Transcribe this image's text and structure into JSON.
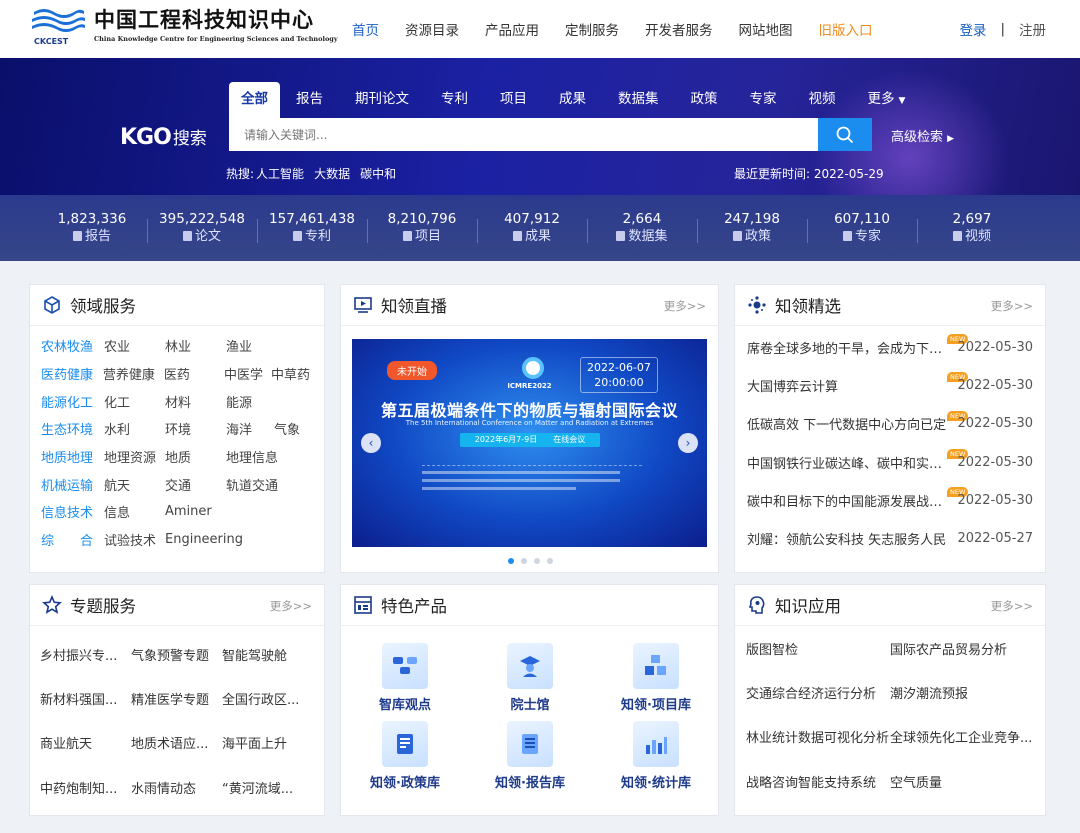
{
  "header": {
    "logo_cn": "中国工程科技知识中心",
    "logo_en": "China Knowledge Centre for Engineering Sciences and Technology",
    "logo_abbr": "CKCEST",
    "nav": [
      "首页",
      "资源目录",
      "产品应用",
      "定制服务",
      "开发者服务",
      "网站地图",
      "旧版入口"
    ],
    "login": "登录",
    "separator": "|",
    "register": "注册"
  },
  "search": {
    "brand": "KGO",
    "brand_cn": "搜索",
    "tabs": [
      "全部",
      "报告",
      "期刊论文",
      "专利",
      "项目",
      "成果",
      "数据集",
      "政策",
      "专家",
      "视频",
      "更多"
    ],
    "placeholder": "请输入关键词...",
    "advanced": "高级检索",
    "hot_label": "热搜:",
    "hot": [
      "人工智能",
      "大数据",
      "碳中和"
    ],
    "update_label": "最近更新时间:",
    "update_date": "2022-05-29"
  },
  "stats": [
    {
      "num": "1,823,336",
      "label": "报告"
    },
    {
      "num": "395,222,548",
      "label": "论文"
    },
    {
      "num": "157,461,438",
      "label": "专利"
    },
    {
      "num": "8,210,796",
      "label": "项目"
    },
    {
      "num": "407,912",
      "label": "成果"
    },
    {
      "num": "2,664",
      "label": "数据集"
    },
    {
      "num": "247,198",
      "label": "政策"
    },
    {
      "num": "607,110",
      "label": "专家"
    },
    {
      "num": "2,697",
      "label": "视频"
    }
  ],
  "domain": {
    "title": "领域服务",
    "rows": [
      {
        "cat": "农林牧渔",
        "items": [
          "农业",
          "林业",
          "渔业"
        ]
      },
      {
        "cat": "医药健康",
        "items": [
          "营养健康",
          "医药",
          "中医学",
          "中草药"
        ]
      },
      {
        "cat": "能源化工",
        "items": [
          "化工",
          "材料",
          "能源"
        ]
      },
      {
        "cat": "生态环境",
        "items": [
          "水利",
          "环境",
          "海洋",
          "气象"
        ]
      },
      {
        "cat": "地质地理",
        "items": [
          "地理资源",
          "地质",
          "地理信息"
        ]
      },
      {
        "cat": "机械运输",
        "items": [
          "航天",
          "交通",
          "轨道交通"
        ]
      },
      {
        "cat": "信息技术",
        "items": [
          "信息",
          "Aminer"
        ]
      },
      {
        "cat": "综　　合",
        "items": [
          "试验技术",
          "Engineering"
        ]
      }
    ]
  },
  "live": {
    "title": "知领直播",
    "more": "更多>>",
    "badge": "未开始",
    "date": "2022-06-07",
    "time": "20:00:00",
    "conf_abbr": "ICMRE2022",
    "banner_title": "第五届极端条件下的物质与辐射国际会议",
    "banner_en": "The 5th International Conference on Matter and Radiation at Extremes",
    "banner_band": "2022年6月7-9日　　在线会议",
    "prev": "‹",
    "next": "›"
  },
  "picks": {
    "title": "知领精选",
    "more": "更多>>",
    "new_label": "NEW",
    "items": [
      {
        "text": "席卷全球多地的干旱，会成为下一...",
        "date": "2022-05-30",
        "new": true
      },
      {
        "text": "大国博弈云计算",
        "date": "2022-05-30",
        "new": true
      },
      {
        "text": "低碳高效 下一代数据中心方向已定",
        "date": "2022-05-30",
        "new": true
      },
      {
        "text": "中国钢铁行业碳达峰、碳中和实施...",
        "date": "2022-05-30",
        "new": true
      },
      {
        "text": "碳中和目标下的中国能源发展战略...",
        "date": "2022-05-30",
        "new": true
      },
      {
        "text": "刘耀：领航公安科技 矢志服务人民",
        "date": "2022-05-27",
        "new": false
      }
    ]
  },
  "topics": {
    "title": "专题服务",
    "more": "更多>>",
    "rows": [
      [
        "乡村振兴专...",
        "气象预警专题",
        "智能驾驶舱"
      ],
      [
        "新材料强国...",
        "精准医学专题",
        "全国行政区..."
      ],
      [
        "商业航天",
        "地质术语应...",
        "海平面上升"
      ],
      [
        "中药炮制知...",
        "水雨情动态",
        "“黄河流域..."
      ]
    ]
  },
  "products": {
    "title": "特色产品",
    "items": [
      "智库观点",
      "院士馆",
      "知领·项目库",
      "知领·政策库",
      "知领·报告库",
      "知领·统计库"
    ]
  },
  "apps": {
    "title": "知识应用",
    "more": "更多>>",
    "rows": [
      [
        "版图智检",
        "国际农产品贸易分析"
      ],
      [
        "交通综合经济运行分析",
        "潮汐潮流预报"
      ],
      [
        "林业统计数据可视化分析",
        "全球领先化工企业竞争..."
      ],
      [
        "战略咨询智能支持系统",
        "空气质量"
      ]
    ]
  },
  "colors": {
    "primary": "#1a5fc4",
    "accent": "#1a8dee",
    "old_entry": "#f08a1c"
  }
}
